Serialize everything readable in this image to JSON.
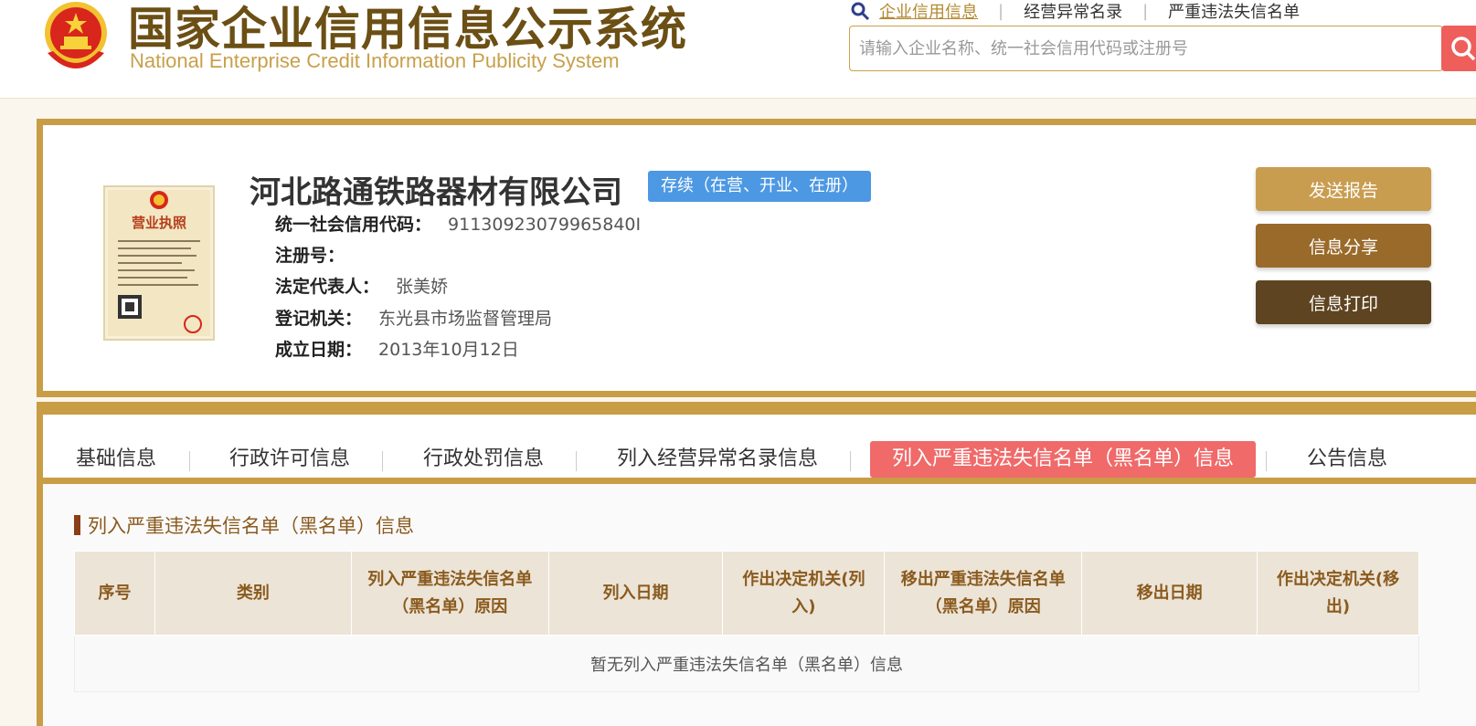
{
  "header": {
    "title_cn": "国家企业信用信息公示系统",
    "title_en": "National Enterprise Credit Information Publicity System",
    "nav": [
      {
        "label": "企业信用信息",
        "active": true
      },
      {
        "label": "经营异常名录",
        "active": false
      },
      {
        "label": "严重违法失信名单",
        "active": false
      }
    ],
    "search_placeholder": "请输入企业名称、统一社会信用代码或注册号"
  },
  "company": {
    "name": "河北路通铁路器材有限公司",
    "status": "存续（在营、开业、在册）",
    "fields": [
      {
        "key": "统一社会信用代码：",
        "value": "91130923079965840I"
      },
      {
        "key": "注册号：",
        "value": ""
      },
      {
        "key": "法定代表人：",
        "value": "张美娇"
      },
      {
        "key": "登记机关：",
        "value": "东光县市场监督管理局"
      },
      {
        "key": "成立日期：",
        "value": "2013年10月12日"
      }
    ],
    "license_title": "营业执照",
    "actions": [
      {
        "label": "发送报告",
        "color": "#c99d50"
      },
      {
        "label": "信息分享",
        "color": "#9a6a2a"
      },
      {
        "label": "信息打印",
        "color": "#5e4420"
      }
    ]
  },
  "tabs": [
    {
      "label": "基础信息",
      "active": false
    },
    {
      "label": "行政许可信息",
      "active": false
    },
    {
      "label": "行政处罚信息",
      "active": false
    },
    {
      "label": "列入经营异常名录信息",
      "active": false
    },
    {
      "label": "列入严重违法失信名单（黑名单）信息",
      "active": true
    },
    {
      "label": "公告信息",
      "active": false
    }
  ],
  "section": {
    "title": "列入严重违法失信名单（黑名单）信息",
    "columns": [
      "序号",
      "类别",
      "列入严重违法失信名单（黑名单）原因",
      "列入日期",
      "作出决定机关(列入)",
      "移出严重违法失信名单（黑名单）原因",
      "移出日期",
      "作出决定机关(移出)"
    ],
    "empty_text": "暂无列入严重违法失信名单（黑名单）信息"
  },
  "colors": {
    "gold": "#c99d45",
    "active_tab": "#f06a6a",
    "badge": "#4d98e3",
    "search_btn": "#ee5f5b"
  }
}
